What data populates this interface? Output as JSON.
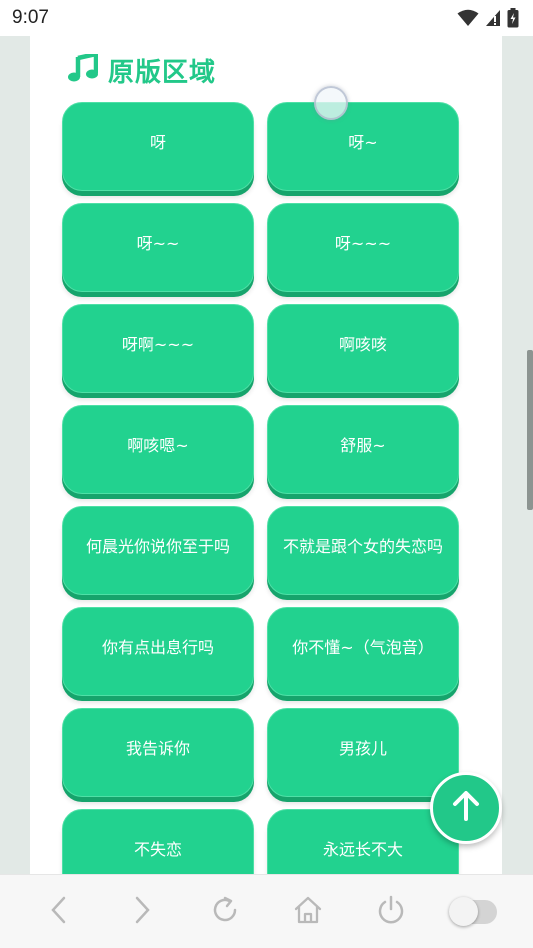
{
  "status_bar": {
    "time": "9:07"
  },
  "section": {
    "title": "原版区域",
    "icon": "music-note-icon",
    "accent_color": "#22c889"
  },
  "sounds": [
    {
      "label": "呀"
    },
    {
      "label": "呀~"
    },
    {
      "label": "呀~~"
    },
    {
      "label": "呀~~~"
    },
    {
      "label": "呀啊~~~"
    },
    {
      "label": "啊咳咳"
    },
    {
      "label": "啊咳嗯~"
    },
    {
      "label": "舒服~"
    },
    {
      "label": "何晨光你说你至于吗"
    },
    {
      "label": "不就是跟个女的失恋吗"
    },
    {
      "label": "你有点出息行吗"
    },
    {
      "label": "你不懂~（气泡音）"
    },
    {
      "label": "我告诉你"
    },
    {
      "label": "男孩儿"
    },
    {
      "label": "不失恋"
    },
    {
      "label": "永远长不大"
    }
  ],
  "colors": {
    "button_face": "#22d28f",
    "button_edge": "#16a46c",
    "card_bg": "#ffffff"
  },
  "floating": {
    "back_to_top_icon": "arrow-up-icon"
  },
  "bottom_bar": {
    "icons": [
      "back-icon",
      "forward-icon",
      "refresh-icon",
      "home-icon",
      "power-icon",
      "toggle-switch"
    ]
  }
}
